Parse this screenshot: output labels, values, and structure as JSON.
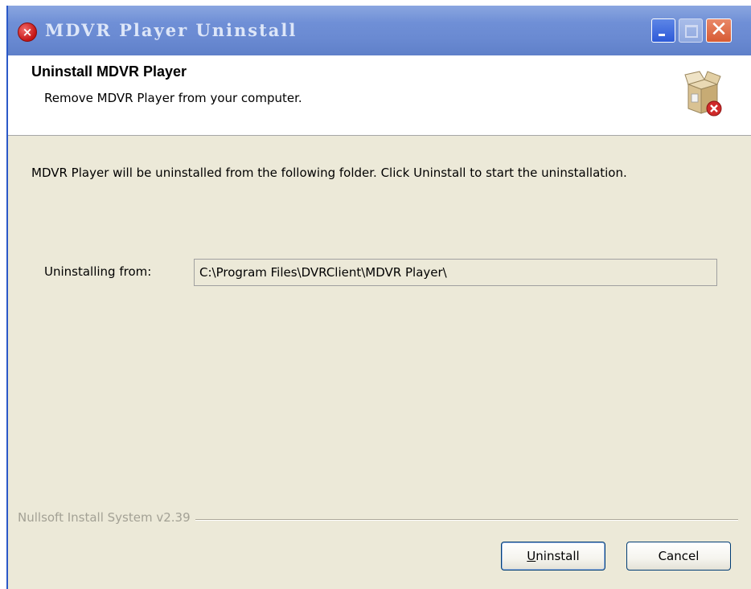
{
  "window": {
    "title": "MDVR Player Uninstall",
    "icon": "uninstall-error-icon",
    "controls": {
      "minimize_icon": "minimize-icon",
      "maximize_icon": "maximize-icon",
      "close_icon": "close-icon",
      "close_glyph": "✕"
    }
  },
  "header": {
    "title": "Uninstall MDVR Player",
    "subtitle": "Remove MDVR Player from your computer.",
    "icon": "package-remove-icon"
  },
  "body": {
    "description": "MDVR Player will be uninstalled from the following folder. Click Uninstall to start the uninstallation.",
    "folder_label": "Uninstalling from:",
    "folder_value": "C:\\Program Files\\DVRClient\\MDVR Player\\"
  },
  "footer": {
    "branding": "Nullsoft Install System v2.39",
    "uninstall_button": {
      "mnemonic": "U",
      "rest": "ninstall"
    },
    "cancel_button": "Cancel"
  },
  "colors": {
    "titlebar": "#6f8fd6",
    "window_bg": "#ece9d8",
    "header_bg": "#ffffff",
    "close_button": "#d75b34",
    "branding_text": "#a3a195"
  }
}
